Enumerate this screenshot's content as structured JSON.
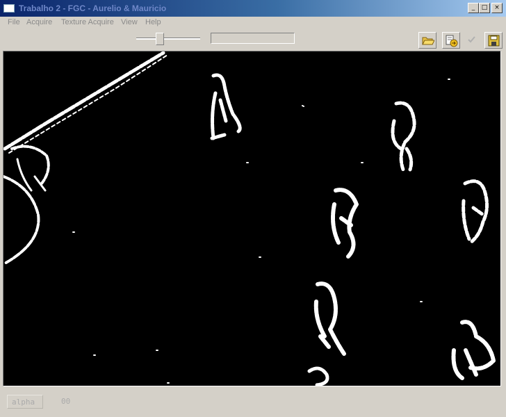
{
  "window": {
    "title": "Trabalho 2 - FGC - Aurelio & Mauricio",
    "minimize_glyph": "_",
    "maximize_glyph": "□",
    "close_glyph": "×"
  },
  "menu": [
    "File",
    "Acquire",
    "Texture Acquire",
    "View",
    "Help"
  ],
  "toolbar": {
    "icons": [
      "open-folder-icon",
      "export-icon",
      "check-icon",
      "save-icon"
    ]
  },
  "canvas": {
    "background": "#000000",
    "foreground": "#ffffff"
  },
  "status": {
    "label": "alpha",
    "value": "00"
  },
  "colors": {
    "title_gradient_start": "#0a246a",
    "title_gradient_end": "#a6caf0",
    "chrome": "#d4d0c8",
    "disabled_text": "#8a8a8a"
  }
}
